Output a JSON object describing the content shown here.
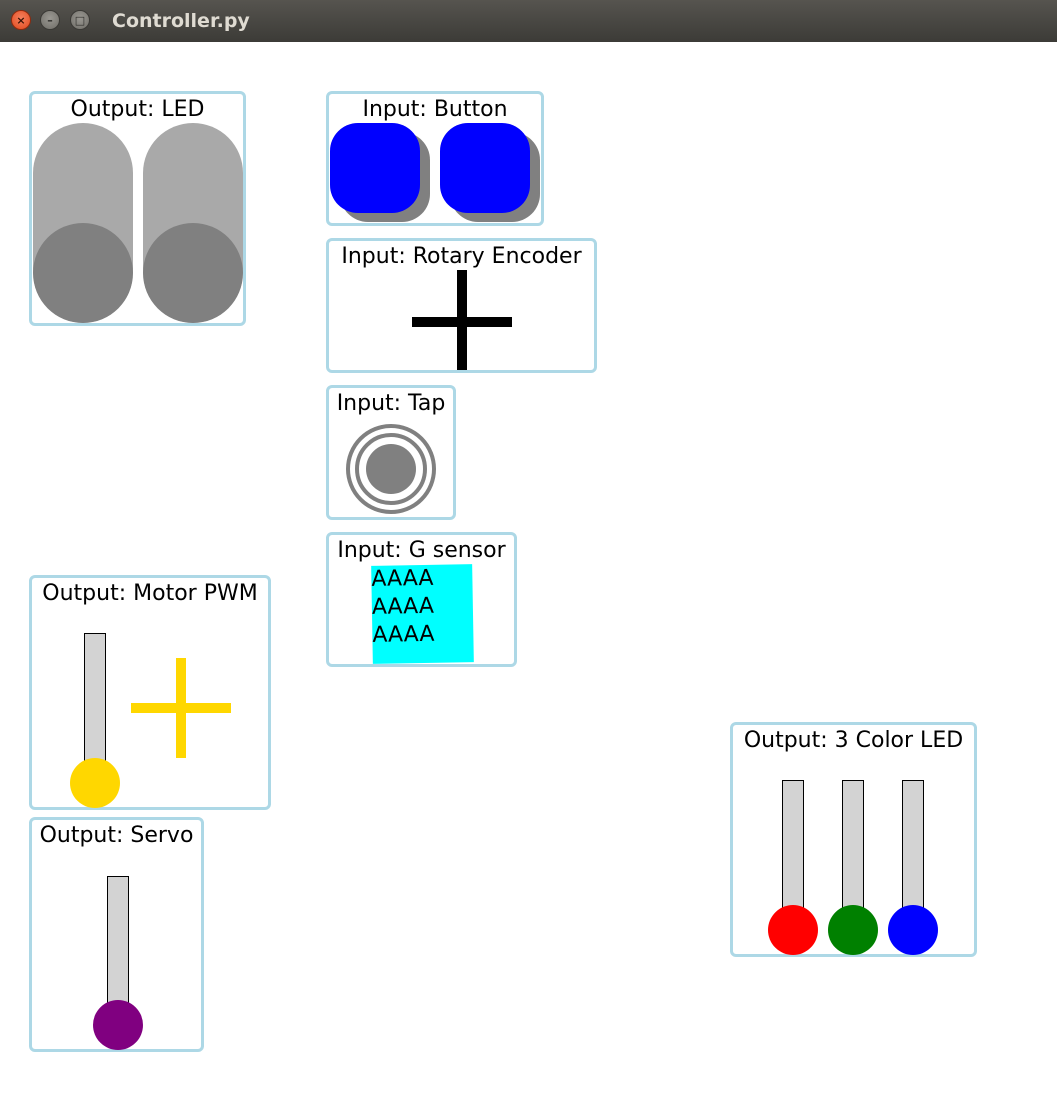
{
  "window": {
    "title": "Controller.py",
    "close_glyph": "×",
    "min_glyph": "–",
    "max_glyph": "□"
  },
  "panels": {
    "led": {
      "title": "Output: LED",
      "levels": [
        0.5,
        0.5
      ]
    },
    "button": {
      "title": "Input: Button"
    },
    "rotary": {
      "title": "Input: Rotary Encoder"
    },
    "tap": {
      "title": "Input: Tap"
    },
    "gsensor": {
      "title": "Input: G sensor",
      "lines": [
        "AAAA",
        "AAAA",
        "AAAA"
      ]
    },
    "motor": {
      "title": "Output: Motor PWM"
    },
    "servo": {
      "title": "Output: Servo"
    },
    "color_led": {
      "title": "Output: 3 Color LED"
    }
  },
  "colors": {
    "panel_border": "#add8e6",
    "button": "#0000ff",
    "motor": "#ffd700",
    "servo": "#800080",
    "red": "#ff0000",
    "green": "#008000",
    "blue": "#0000ff",
    "gsensor_bg": "#00ffff"
  }
}
